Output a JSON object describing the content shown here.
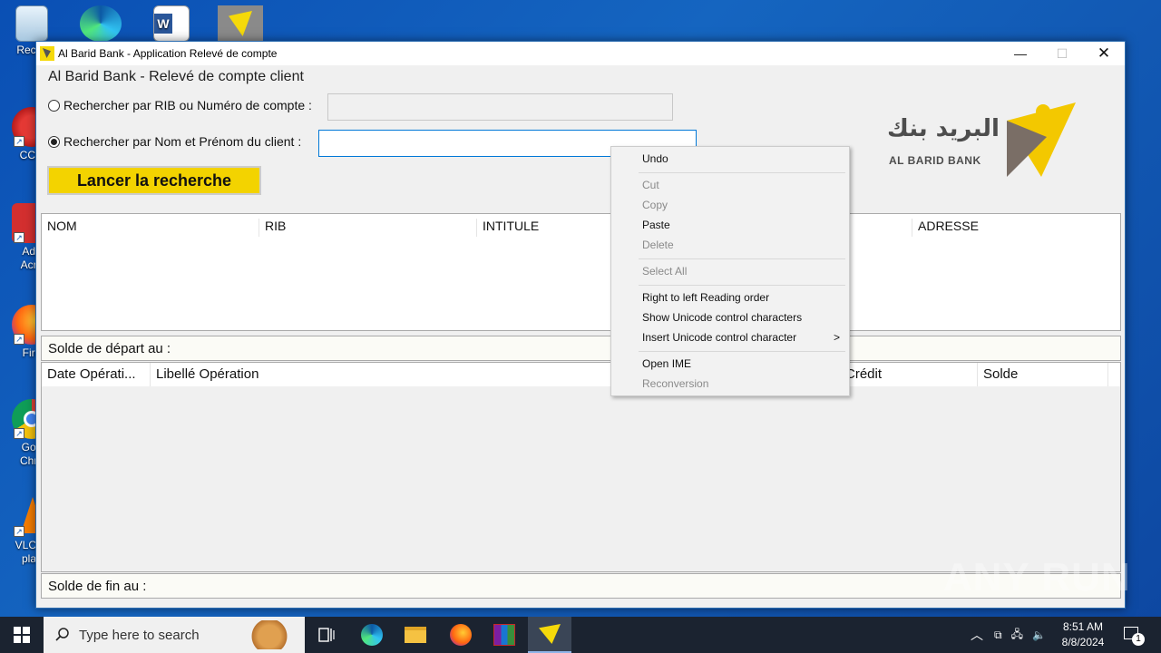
{
  "desktop": {
    "icons": [
      {
        "label": "Recyc",
        "icon": "recycle-bin-icon"
      },
      {
        "label": "CCle",
        "icon": "ccleaner-icon"
      },
      {
        "label": "Ado",
        "label2": "Acro",
        "icon": "adobe-acrobat-icon"
      },
      {
        "label": "Fire",
        "icon": "firefox-icon"
      },
      {
        "label": "Goo",
        "label2": "Chro",
        "icon": "chrome-icon"
      },
      {
        "label": "VLC m",
        "label2": "play",
        "icon": "vlc-icon"
      }
    ]
  },
  "window": {
    "title": "Al Barid Bank - Application Relevé de compte",
    "minimize": "—",
    "maximize": "☐",
    "close": "✕"
  },
  "form": {
    "group_title": "Al Barid Bank - Relevé de compte client",
    "radio_rib_label": "Rechercher par RIB ou Numéro de compte :",
    "radio_rib_checked": false,
    "radio_name_label": "Rechercher par Nom et Prénom du client :",
    "radio_name_checked": true,
    "rib_value": "",
    "name_value": "",
    "search_button": "Lancer la recherche"
  },
  "logo": {
    "arabic": "البريد بنك",
    "latin": "AL BARID BANK"
  },
  "clients_table": {
    "columns": [
      "NOM",
      "RIB",
      "INTITULE",
      "ADRESSE"
    ],
    "rows": []
  },
  "solde_depart_label": "Solde de départ au  :",
  "operations_table": {
    "columns": [
      "Date Opérati...",
      "Libellé Opération",
      "Crédit",
      "Solde"
    ],
    "rows": []
  },
  "solde_fin_label": "Solde de fin au  :",
  "context_menu": {
    "items": [
      {
        "label": "Undo",
        "enabled": true
      },
      {
        "label": "Cut",
        "enabled": false
      },
      {
        "label": "Copy",
        "enabled": false
      },
      {
        "label": "Paste",
        "enabled": true
      },
      {
        "label": "Delete",
        "enabled": false
      },
      {
        "label": "Select All",
        "enabled": false
      },
      {
        "label": "Right to left Reading order",
        "enabled": true
      },
      {
        "label": "Show Unicode control characters",
        "enabled": true
      },
      {
        "label": "Insert Unicode control character",
        "enabled": true,
        "submenu_arrow": ">"
      },
      {
        "label": "Open IME",
        "enabled": true
      },
      {
        "label": "Reconversion",
        "enabled": false
      }
    ]
  },
  "watermark": "ANY RUN",
  "taskbar": {
    "search_placeholder": "Type here to search",
    "time": "8:51 AM",
    "date": "8/8/2024",
    "notification_count": "1"
  }
}
